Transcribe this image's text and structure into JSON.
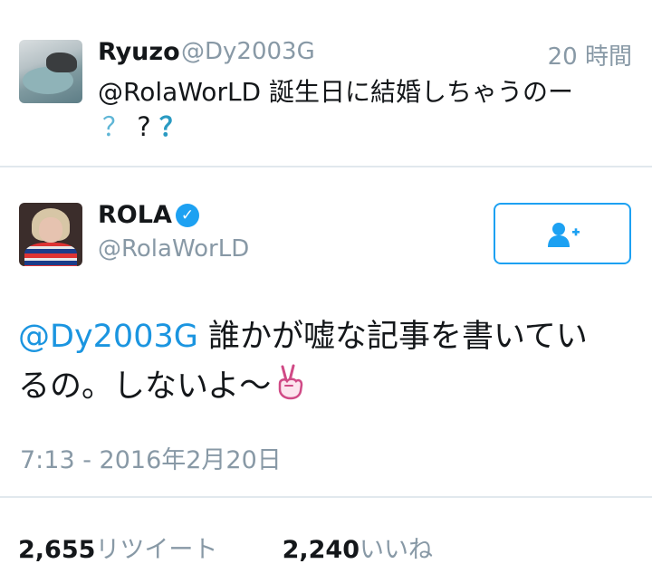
{
  "reply": {
    "name": "Ryuzo",
    "handle": "@Dy2003G",
    "time": "20 時間",
    "text": "@RolaWorLD 誕生日に結婚しちゃうのー",
    "marks": [
      "？",
      "?",
      "？"
    ]
  },
  "tweet": {
    "name": "ROLA",
    "verified": true,
    "handle": "@RolaWorLD",
    "mention": "@Dy2003G",
    "text_line1": " 誰かが嘘な記事を書いてい",
    "text_line2": "るの。しないよ～",
    "emoji": "peace-hand-icon",
    "timestamp": "7:13 - 2016年2月20日",
    "retweets": "2,655",
    "retweets_label": "リツイート",
    "likes": "2,240",
    "likes_label": "いいね"
  },
  "colors": {
    "accent": "#1da1f2",
    "mention": "#1b95e0",
    "muted": "#8899a6"
  }
}
